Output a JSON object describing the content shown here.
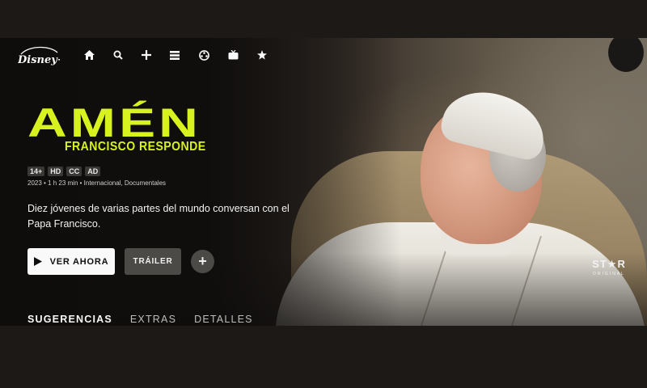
{
  "brand": {
    "logo_text": "Disney+"
  },
  "nav": {
    "items": [
      {
        "icon": "home-icon"
      },
      {
        "icon": "search-icon"
      },
      {
        "icon": "plus-icon"
      },
      {
        "icon": "list-icon"
      },
      {
        "icon": "film-icon"
      },
      {
        "icon": "tv-icon"
      },
      {
        "icon": "star-icon"
      }
    ]
  },
  "title": {
    "main": "AMÉN",
    "subtitle": "FRANCISCO RESPONDE",
    "color": "#d7f21f"
  },
  "badges": [
    "14+",
    "HD",
    "CC",
    "AD"
  ],
  "meta": "2023 • 1 h 23 min • Internacional, Documentales",
  "description": "Diez jóvenes de varias partes del mundo conversan con el Papa Francisco.",
  "buttons": {
    "play_label": "VER AHORA",
    "trailer_label": "TRÁILER",
    "add_label": "+"
  },
  "star_original": {
    "line1": "ST★R",
    "line2": "ORIGINAL"
  },
  "tabs": [
    {
      "label": "SUGERENCIAS",
      "active": true
    },
    {
      "label": "EXTRAS",
      "active": false
    },
    {
      "label": "DETALLES",
      "active": false
    }
  ]
}
